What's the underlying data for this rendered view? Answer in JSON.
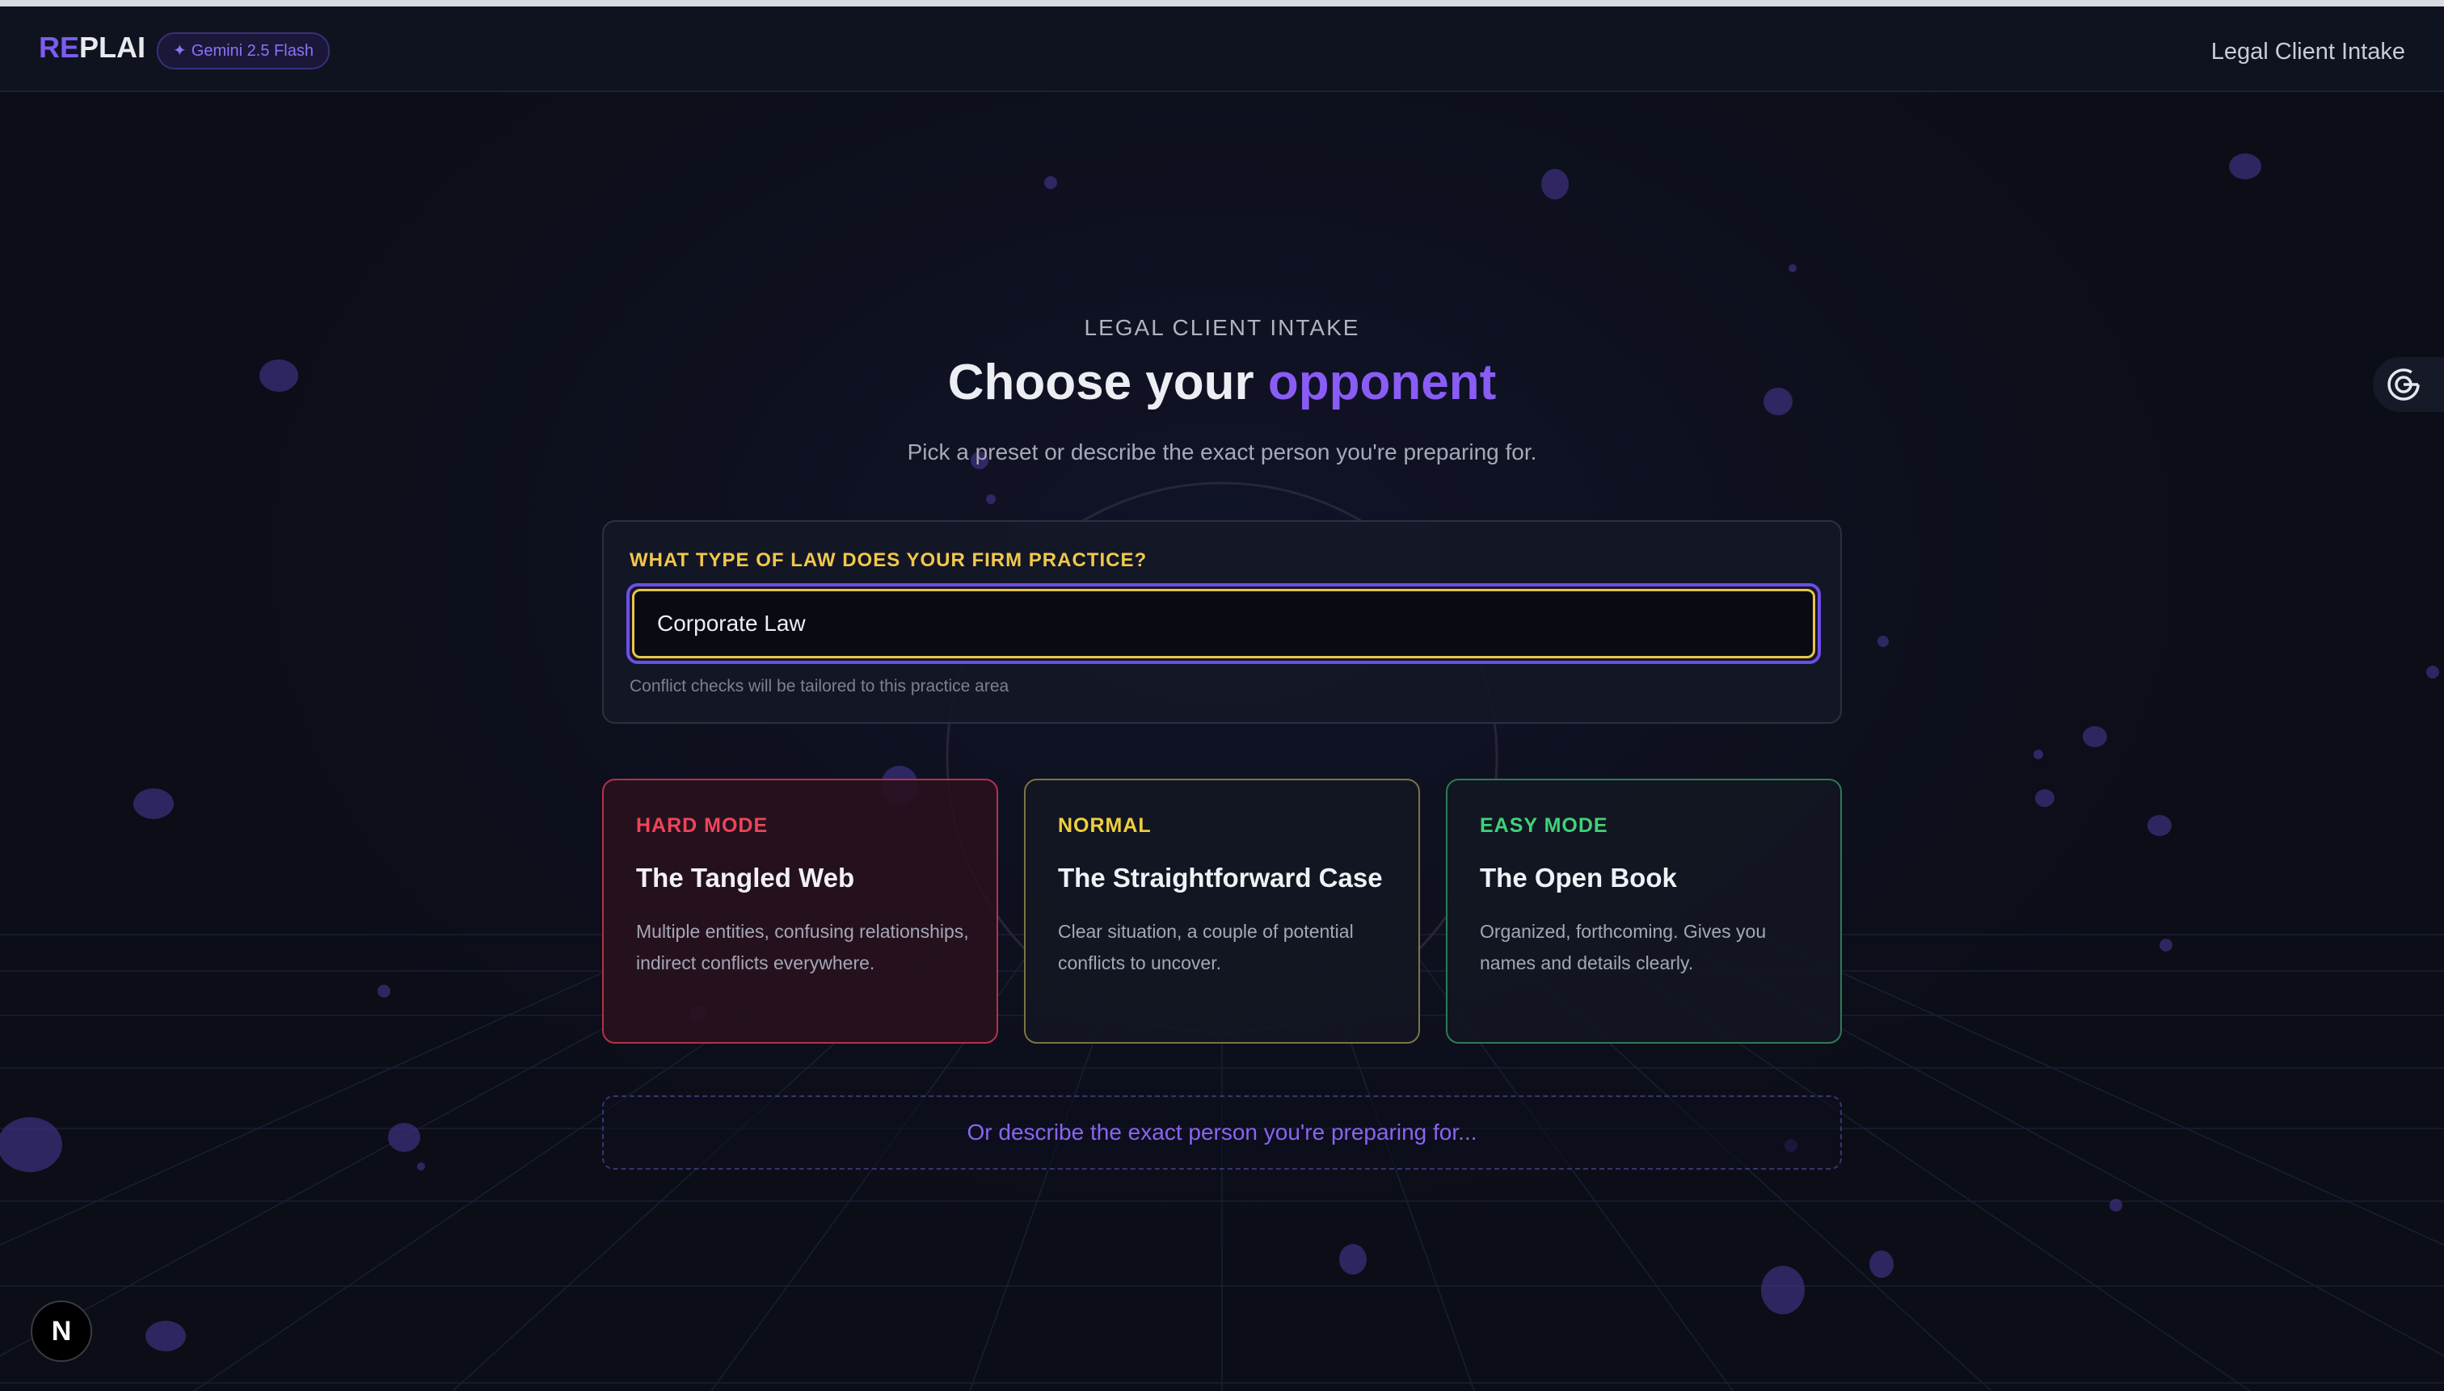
{
  "header": {
    "logo_re": "RE",
    "logo_plai": "PLAI",
    "model_badge": "Gemini 2.5 Flash",
    "right_title": "Legal Client Intake"
  },
  "hero": {
    "eyebrow": "LEGAL CLIENT INTAKE",
    "title_start": "Choose your ",
    "title_accent": "opponent",
    "subtitle": "Pick a preset or describe the exact person you're preparing for."
  },
  "practice": {
    "label": "WHAT TYPE OF LAW DOES YOUR FIRM PRACTICE?",
    "value": "Corporate Law",
    "hint": "Conflict checks will be tailored to this practice area"
  },
  "cards": [
    {
      "tag": "HARD MODE",
      "title": "The Tangled Web",
      "desc": "Multiple entities, confusing relationships, indirect conflicts everywhere."
    },
    {
      "tag": "NORMAL",
      "title": "The Straightforward Case",
      "desc": "Clear situation, a couple of potential conflicts to uncover."
    },
    {
      "tag": "EASY MODE",
      "title": "The Open Book",
      "desc": "Organized, forthcoming. Gives you names and details clearly."
    }
  ],
  "describe_link": "Or describe the exact person you're preparing for...",
  "dev_badge": "N",
  "colors": {
    "accent": "#8a5cf6",
    "hard": "#ef4459",
    "normal": "#f0cf3c",
    "easy": "#3fd27a",
    "label": "#f2c84b"
  },
  "icons": {
    "badge": "sparkle-icon",
    "side": "target-icon"
  }
}
